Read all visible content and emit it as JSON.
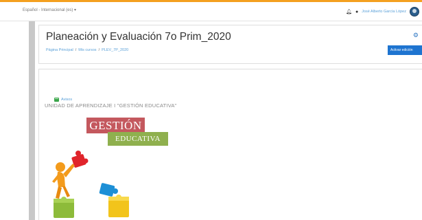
{
  "navbar": {
    "language_menu": "Español - Internacional (es) ▾",
    "notifications_icon": "bell-icon",
    "messages_icon": "chat-bubble-icon",
    "user_name": "José Alberto García López",
    "accent_color": "#f4a020"
  },
  "header": {
    "title": "Planeación y Evaluación 7o Prim_2020",
    "breadcrumb": [
      "Página Principal",
      "Mis cursos",
      "PLEV_7P_2020"
    ],
    "breadcrumb_separator": "/",
    "settings_icon": "gear-icon",
    "edit_button_label": "Activar edición"
  },
  "content": {
    "activity_label": "Avisos",
    "activity_icon": "forum-icon",
    "section_title": "UNIDAD DE APRENDIZAJE I \"GESTIÓN EDUCATIVA\"",
    "banner": {
      "line1": "GESTIÓN",
      "line2": "EDUCATIVA",
      "line1_color": "#c4585e",
      "line2_color": "#8fb04e"
    }
  }
}
